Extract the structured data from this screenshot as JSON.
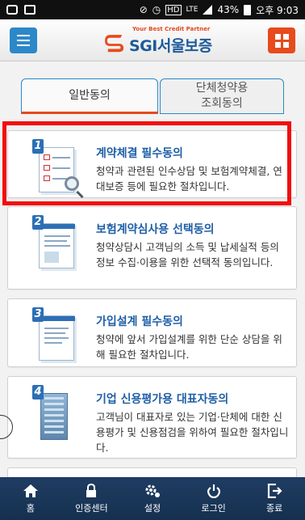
{
  "status_bar": {
    "right_icons": [
      "silent-icon",
      "alarm-icon",
      "hd-icon",
      "lte-icon",
      "signal-icon"
    ],
    "battery": "43%",
    "time": "오후 9:03"
  },
  "header": {
    "logo_tagline": "Your Best Credit Partner",
    "logo_name": "SGI서울보증",
    "brand_colors": {
      "blue": "#2c88c9",
      "orange": "#e74a1c",
      "navy": "#1e5a9b"
    }
  },
  "tabs": [
    {
      "label": "일반동의",
      "active": true
    },
    {
      "label": "단체청약용\n조회동의",
      "active": false
    }
  ],
  "cards": [
    {
      "number": "1",
      "title": "계약체결 필수동의",
      "description": "청약과 관련된 인수상담 및 보험계약체결, 연대보증 등에 필요한 절차입니다."
    },
    {
      "number": "2",
      "title": "보험계약심사용 선택동의",
      "description": "청약상담시 고객님의 소득 및 납세실적 등의 정보 수집·이용을 위한 선택적 동의입니다."
    },
    {
      "number": "3",
      "title": "가입설계 필수동의",
      "description": "청약에 앞서 가입설계를 위한 단순 상담을 위해 필요한 절차입니다."
    },
    {
      "number": "4",
      "title": "기업 신용평가용 대표자동의",
      "description": "고객님이 대표자로 있는 기업·단체에 대한 신용평가 및 신용점검을 위하여 필요한 절차입니다."
    }
  ],
  "bottom_nav": [
    {
      "label": "홈",
      "icon": "home-icon"
    },
    {
      "label": "인증센터",
      "icon": "lock-icon"
    },
    {
      "label": "설정",
      "icon": "gear-icon"
    },
    {
      "label": "로그인",
      "icon": "power-icon"
    },
    {
      "label": "종료",
      "icon": "exit-icon"
    }
  ]
}
